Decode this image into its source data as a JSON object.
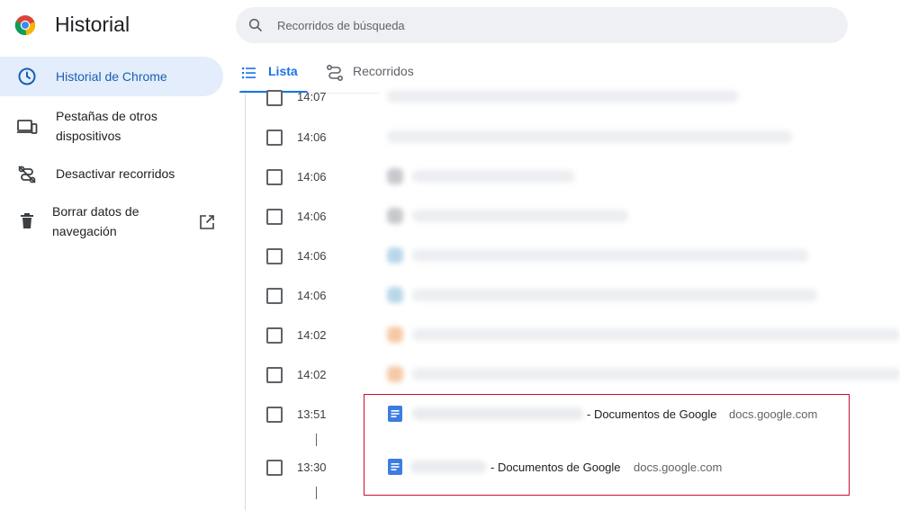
{
  "header": {
    "title": "Historial",
    "search_placeholder": "Recorridos de búsqueda"
  },
  "sidebar": {
    "items": [
      {
        "label": "Historial de Chrome",
        "icon": "clock-icon",
        "active": true
      },
      {
        "label": "Pestañas de otros dispositivos",
        "icon": "devices-icon"
      },
      {
        "label": "Desactivar recorridos",
        "icon": "routes-off-icon"
      },
      {
        "label": "Borrar datos de navegación",
        "icon": "trash-icon",
        "trailing_icon": "open-external-icon"
      }
    ]
  },
  "tabs": [
    {
      "label": "Lista",
      "icon": "list-icon",
      "active": true
    },
    {
      "label": "Recorridos",
      "icon": "routes-icon"
    }
  ],
  "history": [
    {
      "time": "14:07"
    },
    {
      "time": "14:06"
    },
    {
      "time": "14:06"
    },
    {
      "time": "14:06"
    },
    {
      "time": "14:06"
    },
    {
      "time": "14:06"
    },
    {
      "time": "14:02"
    },
    {
      "time": "14:02"
    },
    {
      "time": "13:51",
      "title_suffix": "- Documentos de Google",
      "domain": "docs.google.com"
    },
    {
      "time": "13:30",
      "title_suffix": "- Documentos de Google",
      "domain": "docs.google.com"
    }
  ],
  "colors": {
    "accent": "#1a73e8",
    "active_bg": "#e3edfb",
    "highlight_border": "#c8102e"
  }
}
